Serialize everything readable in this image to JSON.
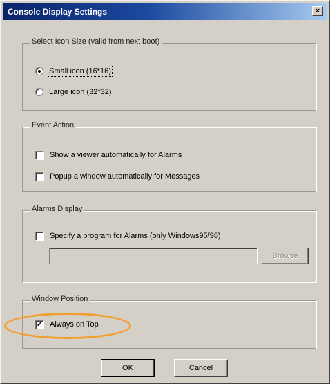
{
  "window": {
    "title": "Console Display Settings",
    "close_glyph": "×"
  },
  "icon_size": {
    "legend": "Select Icon Size (valid from next boot)",
    "options": [
      {
        "label": "Small icon (16*16)",
        "selected": true
      },
      {
        "label": "Large icon (32*32)",
        "selected": false
      }
    ]
  },
  "event_action": {
    "legend": "Event Action",
    "options": [
      {
        "label": "Show a viewer automatically for Alarms",
        "checked": false
      },
      {
        "label": "Popup a window automatically for Messages",
        "checked": false
      }
    ]
  },
  "alarms_display": {
    "legend": "Alarms Display",
    "option": {
      "label": "Specify a program for Alarms (only Windows95/98)",
      "checked": false
    },
    "path_value": "",
    "browse_label": "Browse"
  },
  "window_position": {
    "legend": "Window Position",
    "option": {
      "label": "Always on Top",
      "checked": true,
      "check_glyph": "✓"
    }
  },
  "buttons": {
    "ok": "OK",
    "cancel": "Cancel"
  },
  "colors": {
    "highlight": "#f0a030",
    "titlebar": "#0a246a"
  }
}
